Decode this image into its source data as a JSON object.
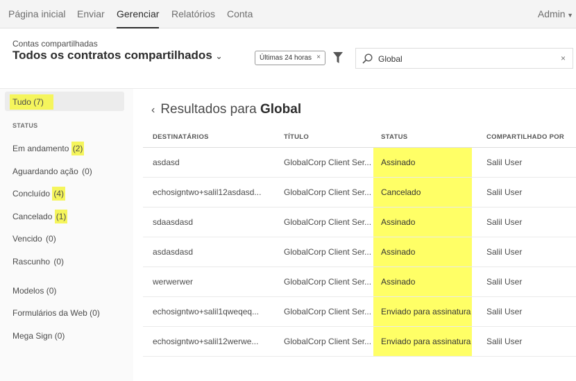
{
  "nav": {
    "items": [
      "Página inicial",
      "Enviar",
      "Gerenciar",
      "Relatórios",
      "Conta"
    ],
    "active": "Gerenciar",
    "user": "Admin"
  },
  "header": {
    "subtitle": "Contas compartilhadas",
    "title": "Todos os contratos compartilhados",
    "filter_chip": "Últimas 24 horas",
    "search_value": "Global"
  },
  "sidebar": {
    "all": {
      "label": "Tudo",
      "count": "(7)"
    },
    "status_heading": "STATUS",
    "status": [
      {
        "label": "Em andamento ",
        "count": "(2)",
        "hl": true
      },
      {
        "label": "Aguardando ação ",
        "count": "(0)"
      },
      {
        "label": "Concluído ",
        "count": "(4)",
        "hl": true
      },
      {
        "label": "Cancelado ",
        "count": "(1)",
        "hl": true
      },
      {
        "label": "Vencido ",
        "count": "(0)"
      },
      {
        "label": "Rascunho ",
        "count": "(0)"
      }
    ],
    "other": [
      {
        "label": "Modelos (0)"
      },
      {
        "label": "Formulários da Web (0)"
      },
      {
        "label": "Mega Sign (0)"
      }
    ]
  },
  "results": {
    "prefix": "Resultados para ",
    "term": "Global"
  },
  "table": {
    "columns": [
      "DESTINATÁRIOS",
      "TÍTULO",
      "STATUS",
      "COMPARTILHADO POR"
    ],
    "rows": [
      [
        "asdasd",
        "GlobalCorp Client Ser...",
        "Assinado",
        "Salil User"
      ],
      [
        "echosigntwo+salil12asdasd...",
        "GlobalCorp Client Ser...",
        "Cancelado",
        "Salil User"
      ],
      [
        "sdaasdasd",
        "GlobalCorp Client Ser...",
        "Assinado",
        "Salil User"
      ],
      [
        "asdasdasd",
        "GlobalCorp Client Ser...",
        "Assinado",
        "Salil User"
      ],
      [
        "werwerwer",
        "GlobalCorp Client Ser...",
        "Assinado",
        "Salil User"
      ],
      [
        "echosigntwo+salil1qweqeq...",
        "GlobalCorp Client Ser...",
        "Enviado para assinatura",
        "Salil User"
      ],
      [
        "echosigntwo+salil12werwe...",
        "GlobalCorp Client Ser...",
        "Enviado para assinatura",
        "Salil User"
      ]
    ]
  },
  "colors": {
    "highlight": "#ffff66"
  }
}
